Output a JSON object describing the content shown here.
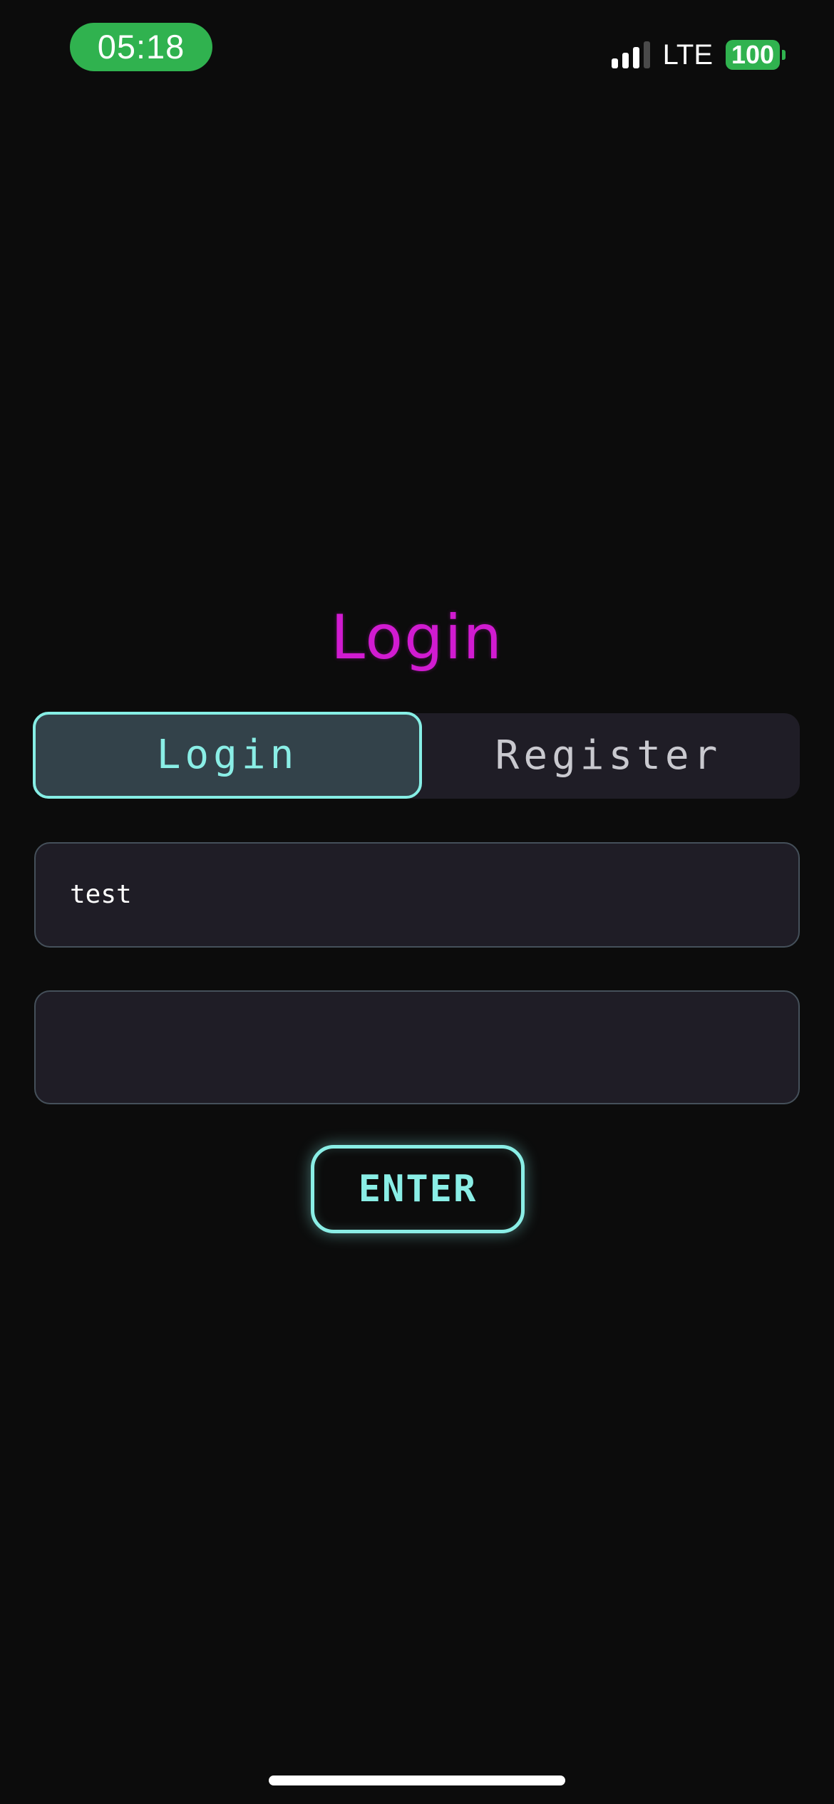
{
  "status_bar": {
    "time": "05:18",
    "network": "LTE",
    "battery": "100",
    "signal_icon": "signal-bars-icon",
    "colors": {
      "time_pill": "#30b24f",
      "battery": "#30b24f"
    }
  },
  "title": "Login",
  "tabs": [
    {
      "label": "Login",
      "selected": true
    },
    {
      "label": "Register",
      "selected": false
    }
  ],
  "form": {
    "username_value": "test",
    "password_value": ""
  },
  "button": {
    "label": "ENTER"
  },
  "colors": {
    "background": "#0c0c0c",
    "title": "#d11bd1",
    "accent": "#8aeee6",
    "field_bg": "#1f1d26"
  }
}
